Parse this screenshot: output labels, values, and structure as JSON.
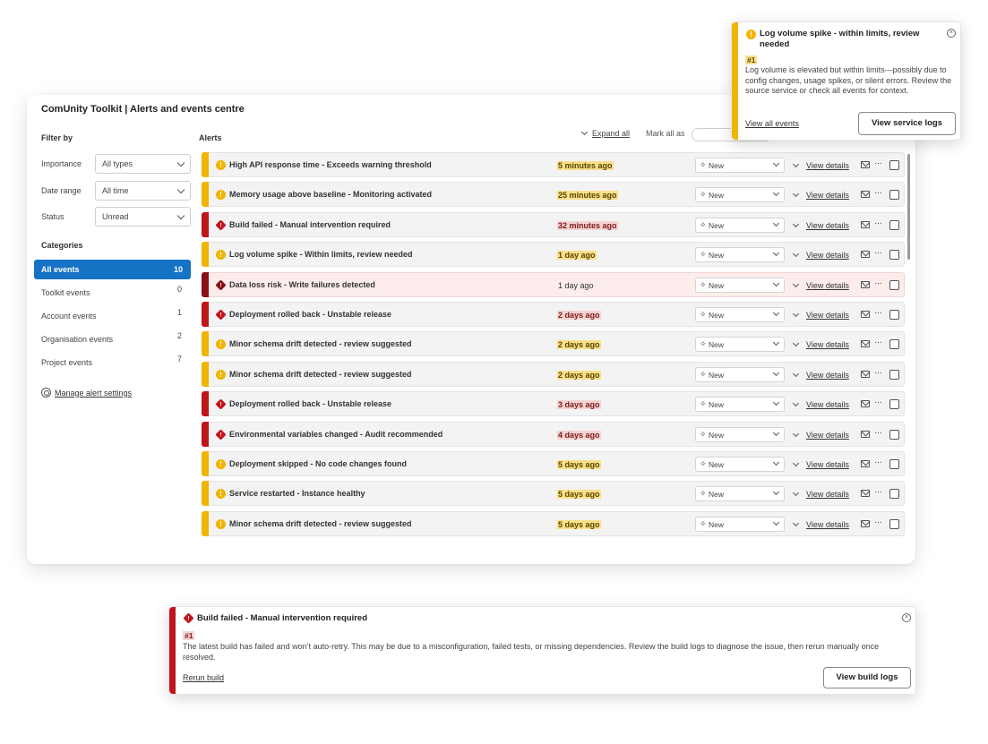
{
  "panel": {
    "title": "ComUnity Toolkit | Alerts and events centre",
    "filter_by": "Filter by",
    "filters": [
      {
        "label": "Importance",
        "value": "All types"
      },
      {
        "label": "Date range",
        "value": "All time"
      },
      {
        "label": "Status",
        "value": "Unread"
      }
    ],
    "categories_title": "Categories",
    "categories": [
      {
        "label": "All events",
        "count": "10",
        "active": true
      },
      {
        "label": "Toolkit events",
        "count": "0"
      },
      {
        "label": "Account events",
        "count": "1"
      },
      {
        "label": "Organisation events",
        "count": "2"
      },
      {
        "label": "Project events",
        "count": "7"
      }
    ],
    "manage_label": "Manage alert settings",
    "alerts_label": "Alerts",
    "expand_all": "Expand all",
    "mark_all_as": "Mark all as"
  },
  "alerts": [
    {
      "title": "High API response time - Exceeds warning threshold",
      "time": "5 minutes ago",
      "severity": "warning",
      "status": "New",
      "view": "View details"
    },
    {
      "title": "Memory usage above baseline - Monitoring activated",
      "time": "25 minutes ago",
      "severity": "warning",
      "status": "New",
      "view": "View details"
    },
    {
      "title": "Build failed - Manual intervention required",
      "time": "32 minutes ago",
      "severity": "error",
      "status": "New",
      "view": "View details"
    },
    {
      "title": "Log volume spike - Within limits, review needed",
      "time": "1 day ago",
      "severity": "warning",
      "status": "New",
      "view": "View details"
    },
    {
      "title": "Data loss risk - Write failures detected",
      "time": "1 day ago",
      "severity": "critical",
      "status": "New",
      "view": "View details"
    },
    {
      "title": "Deployment rolled back - Unstable release",
      "time": "2 days ago",
      "severity": "error",
      "status": "New",
      "view": "View details"
    },
    {
      "title": "Minor schema drift detected - review suggested",
      "time": "2 days ago",
      "severity": "warning",
      "status": "New",
      "view": "View details"
    },
    {
      "title": "Minor schema drift detected - review suggested",
      "time": "2 days ago",
      "severity": "warning",
      "status": "New",
      "view": "View details"
    },
    {
      "title": "Deployment rolled back - Unstable release",
      "time": "3 days ago",
      "severity": "error",
      "status": "New",
      "view": "View details"
    },
    {
      "title": "Environmental variables changed - Audit recommended",
      "time": "4 days ago",
      "severity": "error",
      "status": "New",
      "view": "View details"
    },
    {
      "title": "Deployment skipped - No code changes found",
      "time": "5 days ago",
      "severity": "warning",
      "status": "New",
      "view": "View details"
    },
    {
      "title": "Service restarted - Instance healthy",
      "time": "5 days ago",
      "severity": "warning",
      "status": "New",
      "view": "View details"
    },
    {
      "title": "Minor schema drift detected - review suggested",
      "time": "5 days ago",
      "severity": "warning",
      "status": "New",
      "view": "View details"
    }
  ],
  "toast_warning": {
    "title": "Log volume spike - within limits, review needed",
    "number": "#1",
    "body": "Log volume is elevated but within limits—possibly due to config changes, usage spikes, or silent errors. Review the source service or check all events for context.",
    "link": "View all events",
    "button": "View service logs"
  },
  "toast_error": {
    "title": "Build failed - Manual intervention required",
    "number": "#1",
    "body": "The latest build has failed and won’t auto-retry. This may be due to a misconfiguration, failed tests, or missing dependencies. Review the build logs to diagnose the issue, then rerun manually once resolved.",
    "link": "Rerun build",
    "button": "View build logs"
  },
  "colors": {
    "warning": "#f1b400",
    "error": "#c0141c",
    "critical": "#8a1018",
    "active_blue": "#1672c4"
  }
}
